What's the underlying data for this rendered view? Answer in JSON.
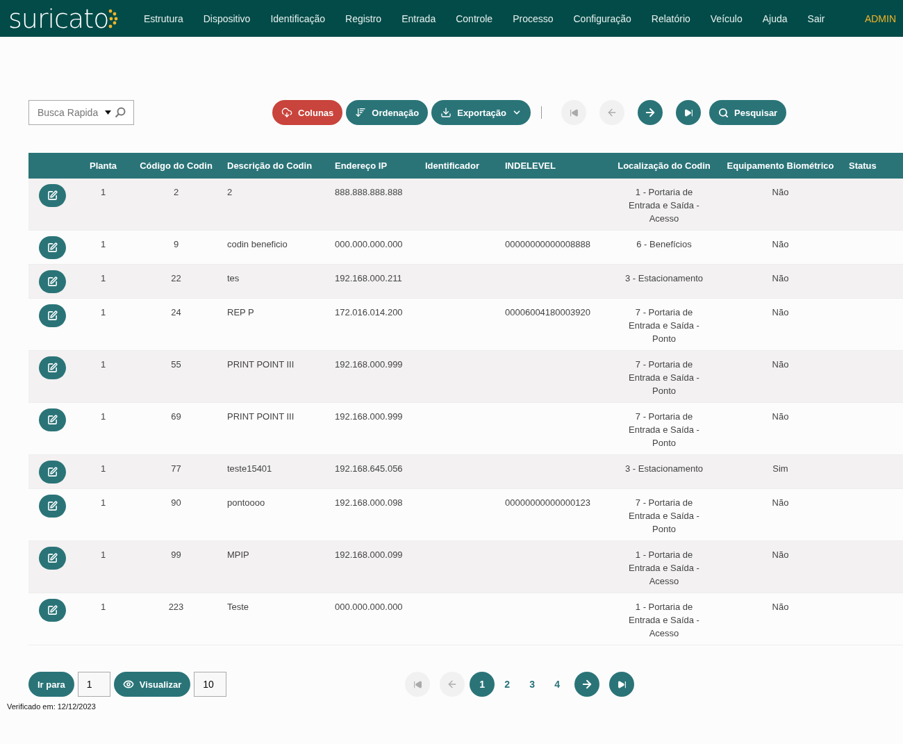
{
  "nav": {
    "logo": "suricato",
    "items": [
      "Estrutura",
      "Dispositivo",
      "Identificação",
      "Registro",
      "Entrada",
      "Controle",
      "Processo",
      "Configuração",
      "Relatório",
      "Veículo",
      "Ajuda",
      "Sair"
    ],
    "user": "ADMIN"
  },
  "toolbar": {
    "search": {
      "placeholder": "Busca Rapida"
    },
    "buttons": [
      {
        "kind": "columns",
        "label": "Colunas",
        "color": "#c9443c"
      },
      {
        "kind": "sort",
        "label": "Ordenação",
        "color": "#2a7478"
      },
      {
        "kind": "export",
        "label": "Exportação",
        "color": "#2a7478"
      }
    ],
    "pager": [
      {
        "kind": "first",
        "disabled": true
      },
      {
        "kind": "prev",
        "disabled": true
      },
      {
        "kind": "next",
        "disabled": false
      },
      {
        "kind": "last",
        "disabled": false
      }
    ],
    "search_button": "Pesquisar"
  },
  "table": {
    "columns": [
      "Planta",
      "Código do Codin",
      "Descrição do Codin",
      "Endereço IP",
      "Identificador",
      "INDELEVEL",
      "Localização do Codin",
      "Equipamento Biométrico",
      "Status"
    ],
    "rows": [
      [
        "1",
        "2",
        "2",
        "888.888.888.888",
        "",
        "",
        "1 - Portaria de Entrada e Saída - Acesso",
        "Não",
        ""
      ],
      [
        "1",
        "9",
        "codin beneficio",
        "000.000.000.000",
        "",
        "00000000000008888",
        "6 - Benefícios",
        "Não",
        ""
      ],
      [
        "1",
        "22",
        "tes",
        "192.168.000.211",
        "",
        "",
        "3 - Estacionamento",
        "Não",
        ""
      ],
      [
        "1",
        "24",
        "REP P",
        "172.016.014.200",
        "",
        "00006004180003920",
        "7 - Portaria de Entrada e Saída - Ponto",
        "Não",
        ""
      ],
      [
        "1",
        "55",
        "PRINT POINT III",
        "192.168.000.999",
        "",
        "",
        "7 - Portaria de Entrada e Saída - Ponto",
        "Não",
        ""
      ],
      [
        "1",
        "69",
        "PRINT POINT III",
        "192.168.000.999",
        "",
        "",
        "7 - Portaria de Entrada e Saída - Ponto",
        "Não",
        ""
      ],
      [
        "1",
        "77",
        "teste15401",
        "192.168.645.056",
        "",
        "",
        "3 - Estacionamento",
        "Sim",
        ""
      ],
      [
        "1",
        "90",
        "pontoooo",
        "192.168.000.098",
        "",
        "00000000000000123",
        "7 - Portaria de Entrada e Saída - Ponto",
        "Não",
        ""
      ],
      [
        "1",
        "99",
        "MPIP",
        "192.168.000.099",
        "",
        "",
        "1 - Portaria de Entrada e Saída - Acesso",
        "Não",
        ""
      ],
      [
        "1",
        "223",
        "Teste",
        "000.000.000.000",
        "",
        "",
        "1 - Portaria de Entrada e Saída - Acesso",
        "Não",
        ""
      ]
    ]
  },
  "footer": {
    "goto_label": "Ir para",
    "goto_value": "1",
    "view_label": "Visualizar",
    "view_value": "10",
    "pager": [
      {
        "kind": "first",
        "disabled": true
      },
      {
        "kind": "prev",
        "disabled": true
      },
      {
        "kind": "page",
        "label": "1",
        "selected": true
      },
      {
        "kind": "page",
        "label": "2",
        "selected": false
      },
      {
        "kind": "page",
        "label": "3",
        "selected": false
      },
      {
        "kind": "page",
        "label": "4",
        "selected": false
      },
      {
        "kind": "next",
        "disabled": false
      },
      {
        "kind": "last",
        "disabled": false
      }
    ]
  },
  "verified": "Verificado em: 12/12/2023"
}
